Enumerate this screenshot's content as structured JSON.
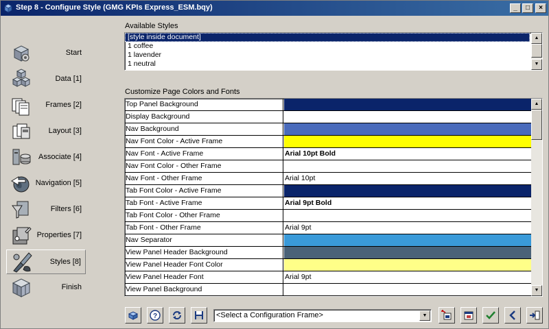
{
  "window": {
    "title": "Step 8 - Configure Style (GMG KPIs Express_ESM.bqy)"
  },
  "sidebar": {
    "items": [
      {
        "label": "Start",
        "icon": "box-gears-icon",
        "active": false
      },
      {
        "label": "Data [1]",
        "icon": "cubes-icon",
        "active": false
      },
      {
        "label": "Frames [2]",
        "icon": "frames-icon",
        "active": false
      },
      {
        "label": "Layout [3]",
        "icon": "layout-icon",
        "active": false
      },
      {
        "label": "Associate [4]",
        "icon": "associate-icon",
        "active": false
      },
      {
        "label": "Navigation [5]",
        "icon": "globe-arrow-icon",
        "active": false
      },
      {
        "label": "Filters [6]",
        "icon": "funnel-icon",
        "active": false
      },
      {
        "label": "Properties [7]",
        "icon": "properties-icon",
        "active": false
      },
      {
        "label": "Styles [8]",
        "icon": "paintbrush-icon",
        "active": true
      },
      {
        "label": "Finish",
        "icon": "cube-finish-icon",
        "active": false
      }
    ]
  },
  "styles": {
    "label": "Available Styles",
    "items": [
      {
        "label": "[style inside document]",
        "selected": true
      },
      {
        "label": "1 coffee",
        "selected": false
      },
      {
        "label": "1 lavender",
        "selected": false
      },
      {
        "label": "1 neutral",
        "selected": false
      }
    ]
  },
  "customize": {
    "label": "Customize Page Colors and Fonts",
    "rows": [
      {
        "name": "Top Panel Background",
        "value": "",
        "color": "#0a246a",
        "bold": false
      },
      {
        "name": "Display Background",
        "value": "",
        "color": "#ffffff",
        "bold": false
      },
      {
        "name": "Nav Background",
        "value": "",
        "color": "#4a6bbb",
        "bold": false
      },
      {
        "name": "Nav Font Color - Active Frame",
        "value": "",
        "color": "#ffff00",
        "bold": false
      },
      {
        "name": "Nav Font - Active Frame",
        "value": "Arial 10pt Bold",
        "color": "#ffffff",
        "bold": true
      },
      {
        "name": "Nav Font Color - Other Frame",
        "value": "",
        "color": "#ffffff",
        "bold": false
      },
      {
        "name": "Nav Font - Other Frame",
        "value": "Arial 10pt",
        "color": "#ffffff",
        "bold": false
      },
      {
        "name": "Tab Font Color - Active Frame",
        "value": "",
        "color": "#0a246a",
        "bold": false
      },
      {
        "name": "Tab Font - Active Frame",
        "value": "Arial 9pt Bold",
        "color": "#ffffff",
        "bold": true
      },
      {
        "name": "Tab Font Color - Other Frame",
        "value": "",
        "color": "#ffffff",
        "bold": false
      },
      {
        "name": "Tab Font - Other Frame",
        "value": "Arial 9pt",
        "color": "#ffffff",
        "bold": false
      },
      {
        "name": "Nav Separator",
        "value": "",
        "color": "#3a9ad9",
        "bold": false
      },
      {
        "name": "View Panel Header Background",
        "value": "",
        "color": "#4a6278",
        "bold": false
      },
      {
        "name": "View Panel Header Font Color",
        "value": "",
        "color": "#ffff88",
        "bold": false
      },
      {
        "name": "View Panel Header Font",
        "value": "Arial 9pt",
        "color": "#ffffff",
        "bold": false
      },
      {
        "name": "View Panel Background",
        "value": "",
        "color": "#ffffff",
        "bold": false
      }
    ]
  },
  "toolbar": {
    "combo_value": "<Select a Configuration Frame>"
  }
}
